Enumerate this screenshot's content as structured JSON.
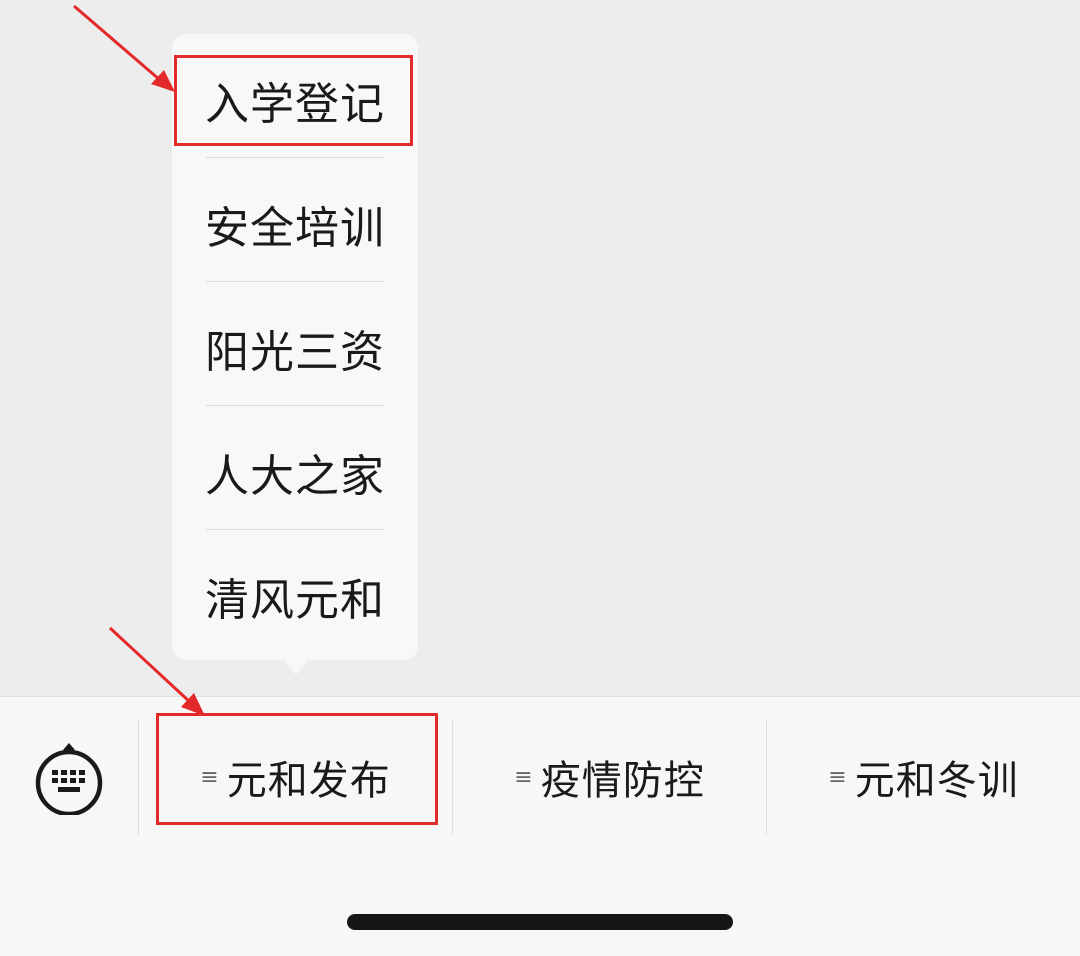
{
  "popup_menu": {
    "items": [
      {
        "label": "入学登记"
      },
      {
        "label": "安全培训"
      },
      {
        "label": "阳光三资"
      },
      {
        "label": "人大之家"
      },
      {
        "label": "清风元和"
      }
    ]
  },
  "tab_bar": {
    "keyboard_icon": "keyboard-icon",
    "menu_icon_glyph": "≡",
    "tabs": [
      {
        "label": "元和发布"
      },
      {
        "label": "疫情防控"
      },
      {
        "label": "元和冬训"
      }
    ]
  },
  "colors": {
    "annotation_red": "#e4292a",
    "background": "#ededed",
    "menu_background": "#f8f8f8",
    "tab_bar_background": "#f7f7f7"
  }
}
